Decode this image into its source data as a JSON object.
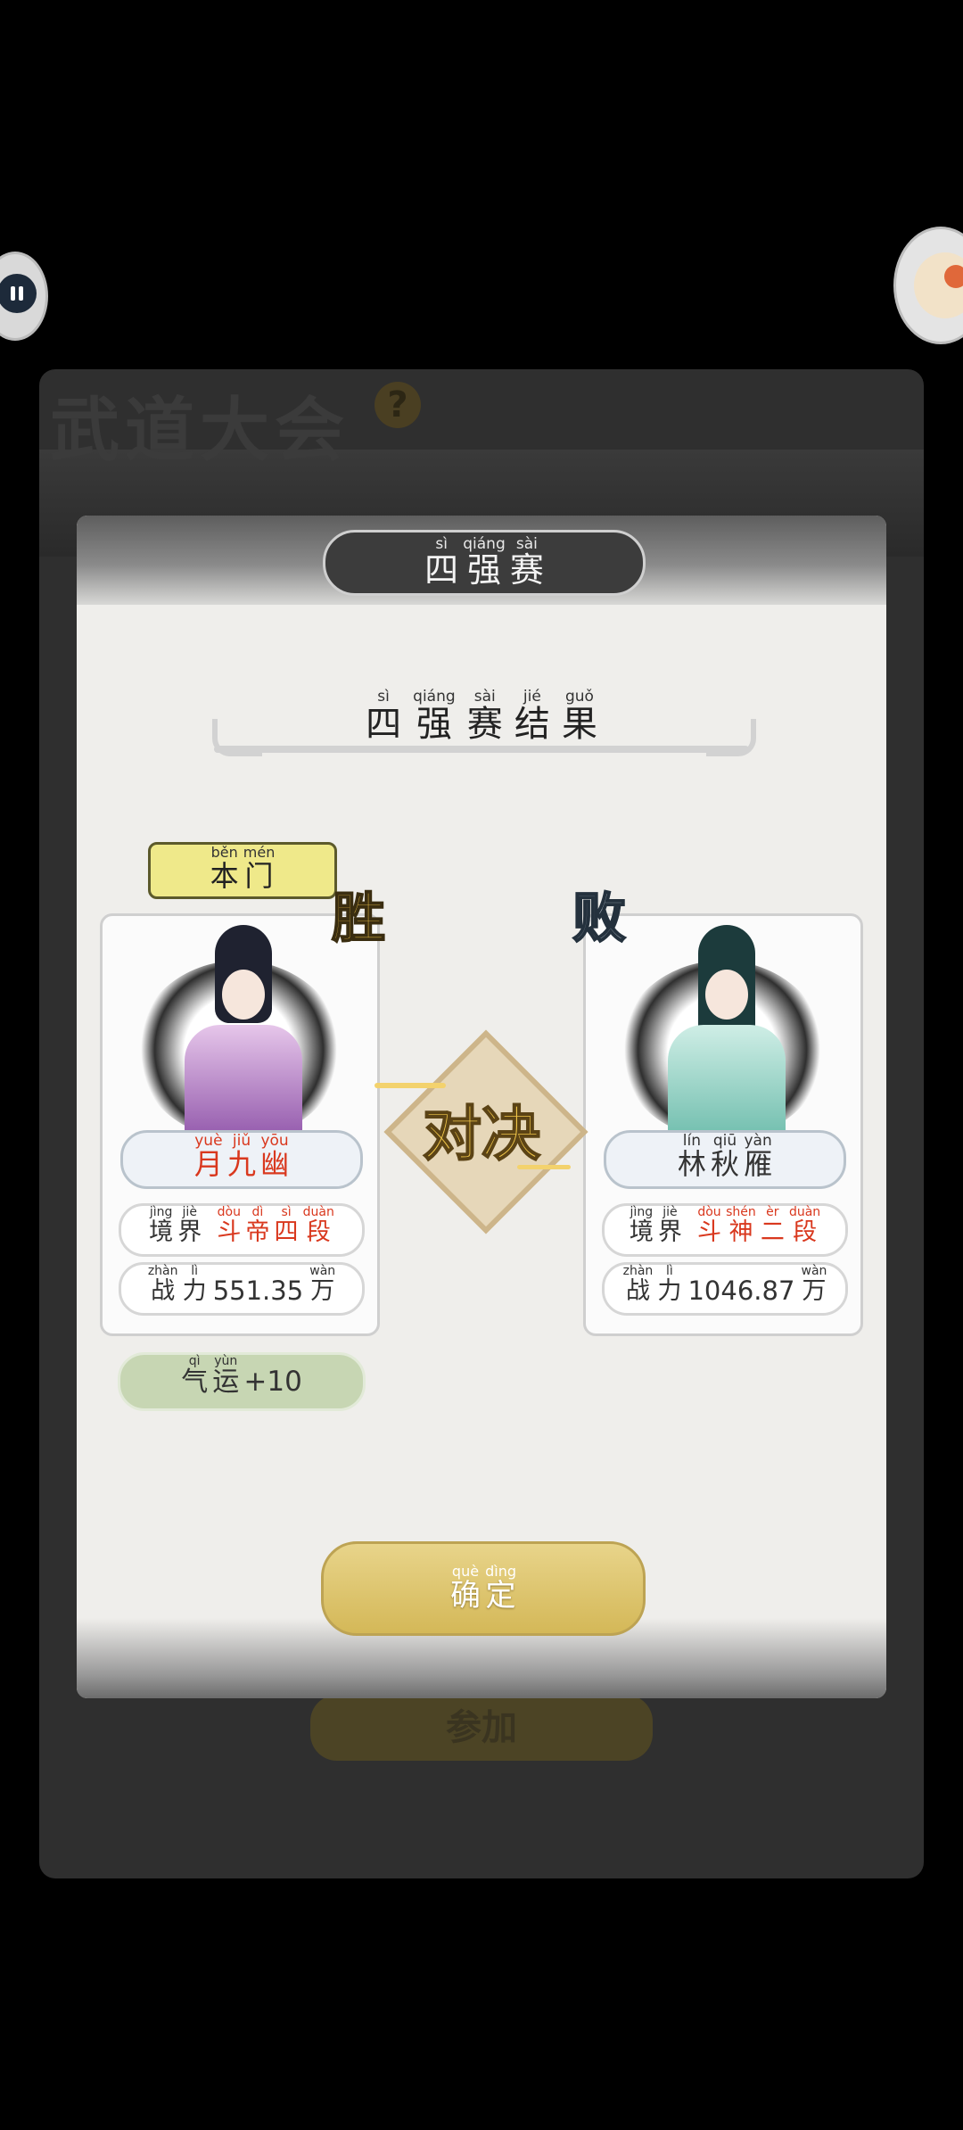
{
  "background": {
    "title": "武道大会",
    "help_icon": "?",
    "join_label": "参加"
  },
  "dialog": {
    "title": {
      "py": [
        "sì",
        "qiáng",
        "sài"
      ],
      "hz": [
        "四",
        "强",
        "赛"
      ]
    },
    "result_heading": {
      "py": [
        "sì",
        "qiáng",
        "sài",
        "jié",
        "guǒ"
      ],
      "hz": [
        "四",
        "强",
        "赛",
        "结",
        "果"
      ]
    },
    "our_sect": {
      "py": [
        "běn",
        "mén"
      ],
      "hz": [
        "本",
        "门"
      ]
    },
    "duel_text": "对决",
    "left": {
      "badge": "胜",
      "name": {
        "py": [
          "yuè",
          "jiǔ",
          "yōu"
        ],
        "hz": [
          "月",
          "九",
          "幽"
        ]
      },
      "realm_label": {
        "py": [
          "jìng",
          "jiè"
        ],
        "hz": [
          "境",
          "界"
        ]
      },
      "realm_value": {
        "py": [
          "dòu",
          "dì",
          "sì",
          "duàn"
        ],
        "hz": [
          "斗",
          "帝",
          "四",
          "段"
        ]
      },
      "power_label": {
        "py": [
          "zhàn",
          "lì"
        ],
        "hz": [
          "战",
          "力"
        ]
      },
      "power_value": "551.35",
      "power_unit": {
        "py": [
          "wàn"
        ],
        "hz": [
          "万"
        ]
      }
    },
    "right": {
      "badge": "败",
      "name": {
        "py": [
          "lín",
          "qiū",
          "yàn"
        ],
        "hz": [
          "林",
          "秋",
          "雁"
        ]
      },
      "realm_label": {
        "py": [
          "jìng",
          "jiè"
        ],
        "hz": [
          "境",
          "界"
        ]
      },
      "realm_value": {
        "py": [
          "dòu",
          "shén",
          "èr",
          "duàn"
        ],
        "hz": [
          "斗",
          "神",
          "二",
          "段"
        ]
      },
      "power_label": {
        "py": [
          "zhàn",
          "lì"
        ],
        "hz": [
          "战",
          "力"
        ]
      },
      "power_value": "1046.87",
      "power_unit": {
        "py": [
          "wàn"
        ],
        "hz": [
          "万"
        ]
      }
    },
    "luck": {
      "py": [
        "qì",
        "yùn"
      ],
      "hz": [
        "气",
        "运"
      ],
      "value": "+10"
    },
    "confirm": {
      "py": [
        "què",
        "dìng"
      ],
      "hz": [
        "确",
        "定"
      ]
    }
  },
  "icons": {
    "pause": "pause-icon",
    "pet": "pet-avatar-icon"
  },
  "colors": {
    "accent_gold": "#f2c74a",
    "highlight_red": "#d9381e",
    "dialog_bg": "#efeeeb"
  }
}
